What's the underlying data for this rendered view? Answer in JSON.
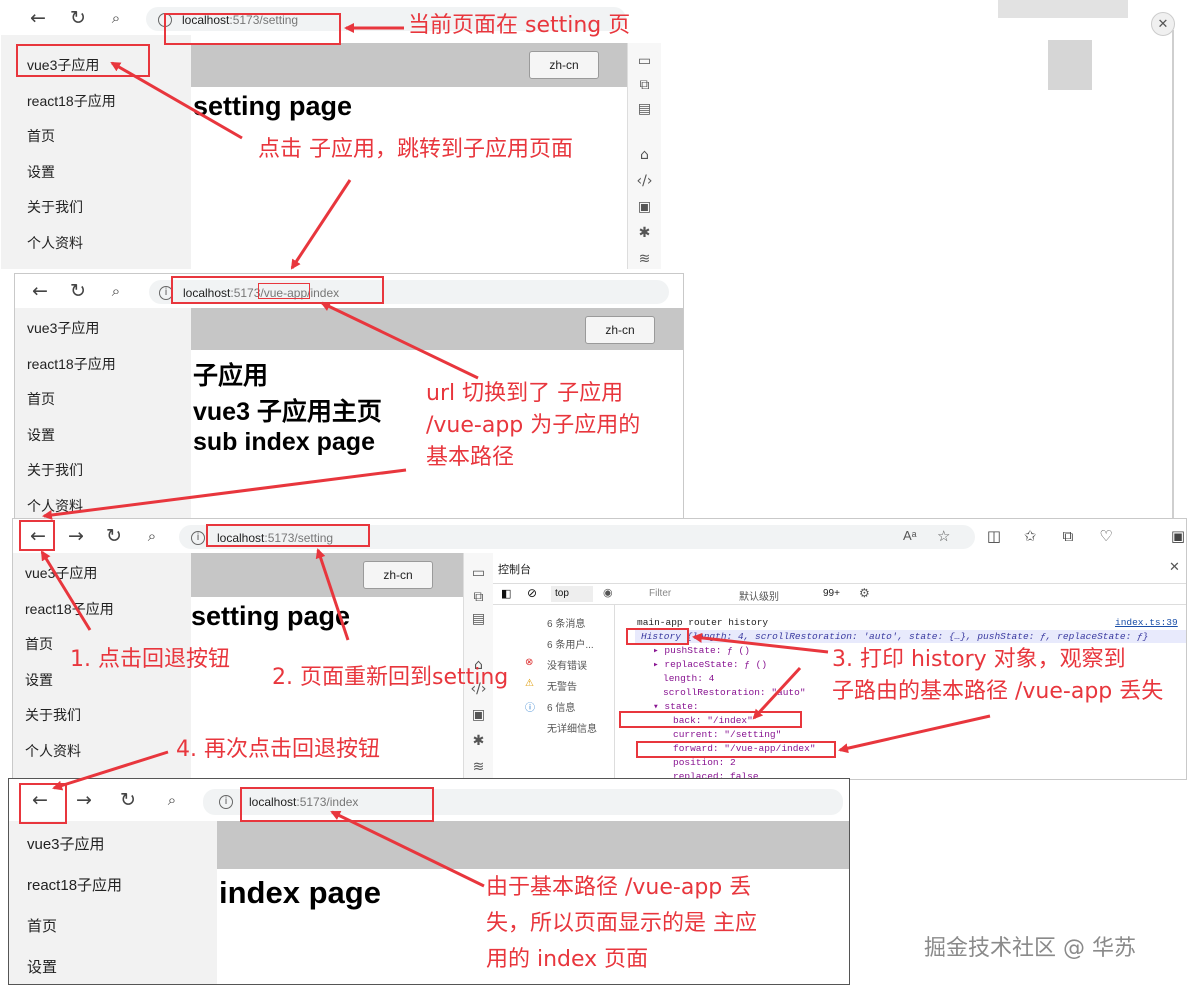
{
  "shot1": {
    "url_host": "localhost",
    "url_path": ":5173/setting",
    "nav": [
      "vue3子应用",
      "react18子应用",
      "首页",
      "设置",
      "关于我们",
      "个人资料"
    ],
    "lang_button": "zh-cn",
    "heading": "setting page"
  },
  "shot2": {
    "url_host": "localhost",
    "url_port": ":5173/",
    "url_base": "vue-app",
    "url_rest": "/index",
    "nav": [
      "vue3子应用",
      "react18子应用",
      "首页",
      "设置",
      "关于我们",
      "个人资料"
    ],
    "lang_button": "zh-cn",
    "headings": [
      "子应用",
      "vue3 子应用主页",
      "sub index page"
    ]
  },
  "shot3": {
    "url_host": "localhost",
    "url_path": ":5173/setting",
    "nav": [
      "vue3子应用",
      "react18子应用",
      "首页",
      "设置",
      "关于我们",
      "个人资料"
    ],
    "lang_button": "zh-cn",
    "heading": "setting page",
    "devtools": {
      "tab_title": "控制台",
      "context": "top",
      "filter_placeholder": "Filter",
      "levels": "默认级别",
      "issues_count": "99+",
      "sidebar": [
        "6 条消息",
        "6 条用户...",
        "没有错误",
        "无警告",
        "6 信息",
        "无详细信息"
      ],
      "log_label": "main-app router history",
      "log_source": "index.ts:39",
      "history_summary": "History {length: 4, scrollRestoration: 'auto', state: {…}, pushState: ƒ, replaceState: ƒ}",
      "lines": {
        "pushState": "▸ pushState: ƒ ()",
        "replaceState": "▸ replaceState: ƒ ()",
        "length": "length: 4",
        "scroll": "scrollRestoration: \"auto\"",
        "state": "▾ state:",
        "back": "back: \"/index\"",
        "current": "current: \"/setting\"",
        "forward": "forward: \"/vue-app/index\"",
        "position": "position: 2",
        "replaced": "replaced: false"
      }
    }
  },
  "shot4": {
    "url_host": "localhost",
    "url_path": ":5173/index",
    "nav": [
      "vue3子应用",
      "react18子应用",
      "首页",
      "设置"
    ],
    "heading": "index page"
  },
  "annotations": {
    "a1": "当前页面在 setting 页",
    "a2": "点击 子应用，跳转到子应用页面",
    "a3_l1": "url 切换到了 子应用",
    "a3_l2": "/vue-app 为子应用的",
    "a3_l3": "基本路径",
    "a4": "1. 点击回退按钮",
    "a5": "2. 页面重新回到setting",
    "a6_l1": "3. 打印 history 对象，观察到",
    "a6_l2": "子路由的基本路径 /vue-app 丢失",
    "a7": "4. 再次点击回退按钮",
    "a8_l1": "由于基本路径 /vue-app 丢",
    "a8_l2": "失，所以页面显示的是 主应",
    "a8_l3": "用的 index 页面"
  },
  "watermark": "掘金技术社区 @ 华苏",
  "colors": {
    "annotation_red": "#e8363d",
    "sidebar_bg": "#f2f2f2",
    "header_grey": "#c6c6c6"
  }
}
